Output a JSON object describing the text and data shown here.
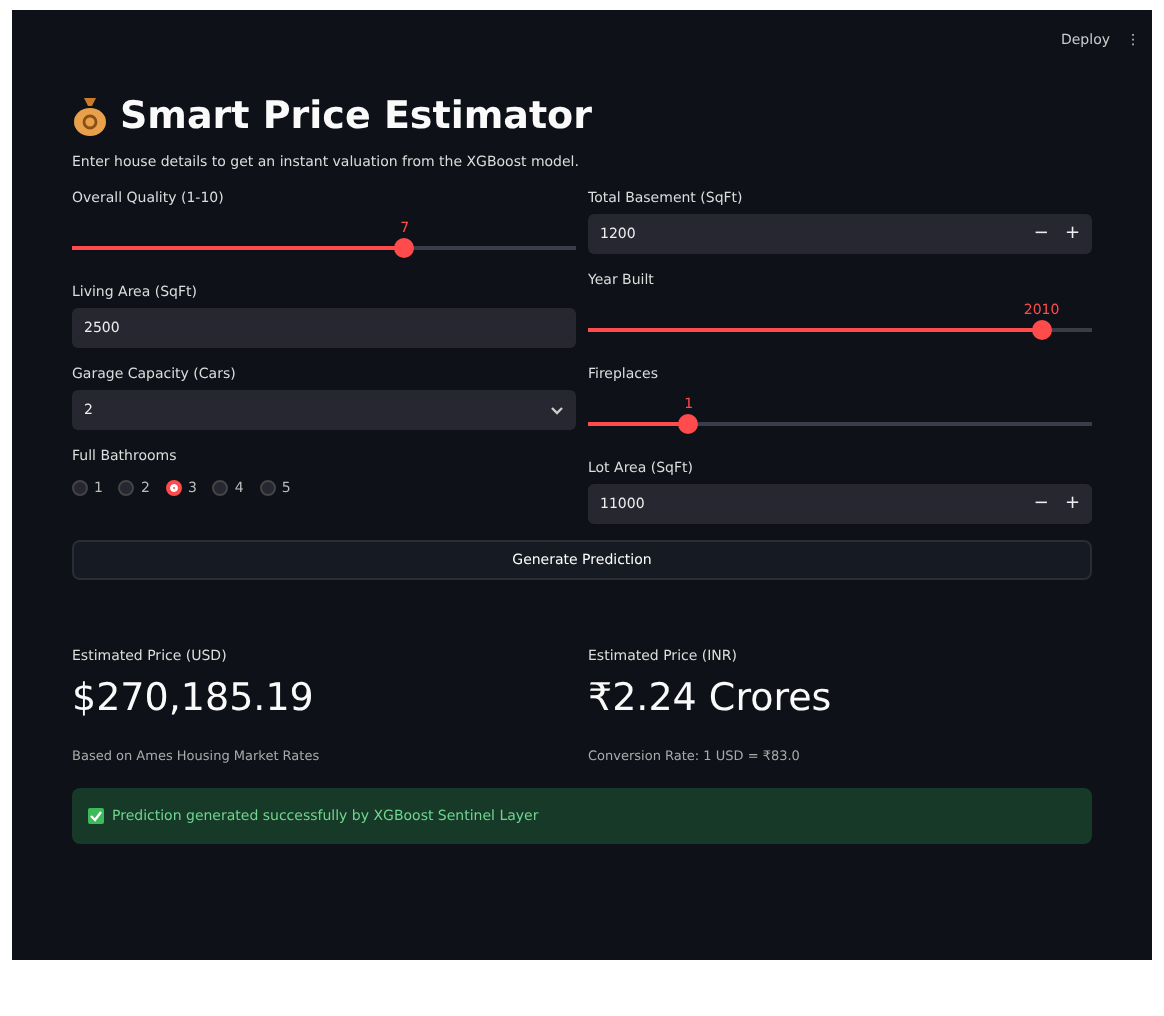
{
  "header": {
    "deploy": "Deploy",
    "menu": "⋮"
  },
  "title": "Smart Price Estimator",
  "subtitle": "Enter house details to get an instant valuation from the XGBoost model.",
  "columns": [
    [
      {
        "kind": "slider",
        "label": "Overall Quality (1-10)",
        "value": "7",
        "level": 0.66
      },
      {
        "kind": "text",
        "label": "Living Area (SqFt)",
        "value": "2500"
      },
      {
        "kind": "select",
        "label": "Garage Capacity (Cars)",
        "value": "2"
      },
      {
        "kind": "radio",
        "label": "Full Bathrooms",
        "options": [
          {
            "label": "1",
            "selected": false
          },
          {
            "label": "2",
            "selected": false
          },
          {
            "label": "3",
            "selected": true
          },
          {
            "label": "4",
            "selected": false
          },
          {
            "label": "5",
            "selected": false
          }
        ]
      }
    ],
    [
      {
        "kind": "number",
        "label": "Total Basement (SqFt)",
        "value": "1200",
        "minus": "−",
        "plus": "+"
      },
      {
        "kind": "slider",
        "label": "Year Built",
        "value": "2010",
        "level": 0.9
      },
      {
        "kind": "slider",
        "label": "Fireplaces",
        "value": "1",
        "level": 0.2
      },
      {
        "kind": "number",
        "label": "Lot Area (SqFt)",
        "value": "11000",
        "minus": "−",
        "plus": "+"
      }
    ]
  ],
  "button": "Generate Prediction",
  "results": [
    {
      "label": "Estimated Price (USD)",
      "value": "$270,185.19",
      "caption": "Based on Ames Housing Market Rates"
    },
    {
      "label": "Estimated Price (INR)",
      "value": "₹2.24 Crores",
      "caption": "Conversion Rate: 1 USD = ₹83.0"
    }
  ],
  "alert": {
    "kind": "success",
    "text": "Prediction generated successfully by XGBoost Sentinel Layer"
  }
}
